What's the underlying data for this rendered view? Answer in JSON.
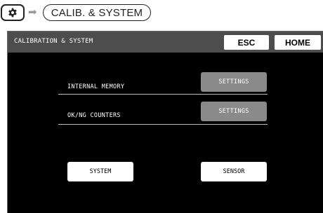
{
  "breadcrumb": {
    "gear_icon": "gear-icon",
    "arrow_icon": "right-arrow-icon",
    "target_label": "CALIB. & SYSTEM"
  },
  "screen": {
    "title": "CALIBRATION & SYSTEM",
    "esc_label": "ESC",
    "home_label": "HOME",
    "rows": [
      {
        "label": "INTERNAL MEMORY",
        "button_label": "SETTINGS"
      },
      {
        "label": "OK/NG COUNTERS",
        "button_label": "SETTINGS"
      }
    ],
    "system_label": "SYSTEM",
    "sensor_label": "SENSOR"
  },
  "colors": {
    "screen_bg": "#000000",
    "topbar_bg": "#4d4d4d",
    "settings_button_bg": "#8a8a8a",
    "button_bg": "#ffffff"
  }
}
